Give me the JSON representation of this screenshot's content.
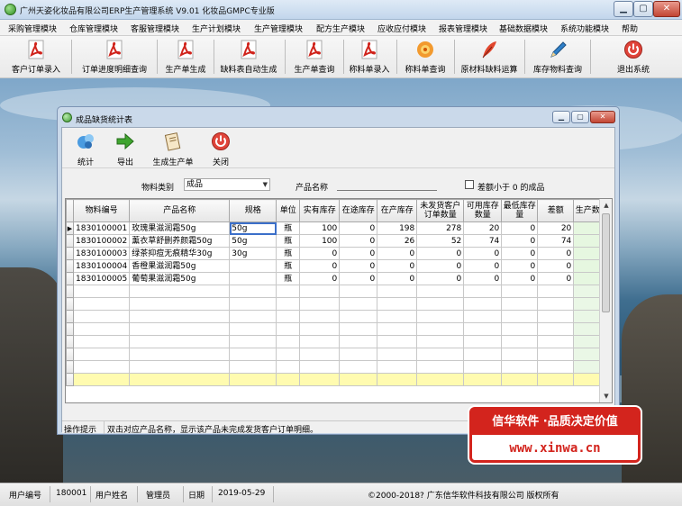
{
  "window": {
    "title": "广州天姿化妆品有限公司ERP生产管理系统  V9.01 化妆品GMPC专业版"
  },
  "menu": [
    "采购管理模块",
    "仓库管理模块",
    "客服管理模块",
    "生产计划模块",
    "生产管理模块",
    "配方生产模块",
    "应收应付模块",
    "报表管理模块",
    "基础数据模块",
    "系统功能模块",
    "帮助"
  ],
  "toolbar": [
    {
      "label": "客户订单录入",
      "icon": "pdf-document-icon"
    },
    {
      "label": "订单进度明细查询",
      "icon": "pdf-document-icon"
    },
    {
      "label": "生产单生成",
      "icon": "pdf-document-icon"
    },
    {
      "label": "缺料表自动生成",
      "icon": "pdf-document-icon"
    },
    {
      "label": "生产单查询",
      "icon": "pdf-document-icon"
    },
    {
      "label": "称料单录入",
      "icon": "pdf-document-icon"
    },
    {
      "label": "称料单查询",
      "icon": "gear-flower-icon"
    },
    {
      "label": "原材料缺料运算",
      "icon": "feather-quill-icon"
    },
    {
      "label": "库存物料查询",
      "icon": "pen-icon"
    },
    {
      "label": "退出系统",
      "icon": "power-icon"
    }
  ],
  "child": {
    "title": "成品缺货统计表",
    "toolbar": [
      "统计",
      "导出",
      "生成生产单",
      "关闭"
    ],
    "filter": {
      "category_label": "物料类别",
      "category_value": "成品",
      "product_label": "产品名称",
      "product_value": "",
      "checkbox_label": "差额小于 0 的成品"
    },
    "columns": [
      "物料编号",
      "产品名称",
      "规格",
      "单位",
      "实有库存",
      "在途库存",
      "在产库存",
      "未发货客户订单数量",
      "可用库存数量",
      "最低库存量",
      "差额",
      "生产数量"
    ],
    "rows": [
      [
        "1830100001",
        "玫瑰果滋润霜50g",
        "50g",
        "瓶",
        "100",
        "0",
        "198",
        "278",
        "20",
        "0",
        "20",
        ""
      ],
      [
        "1830100002",
        "薰衣草舒删养颜霜50g",
        "50g",
        "瓶",
        "100",
        "0",
        "26",
        "52",
        "74",
        "0",
        "74",
        ""
      ],
      [
        "1830100003",
        "绿茶抑痘无痕精华30g",
        "30g",
        "瓶",
        "0",
        "0",
        "0",
        "0",
        "0",
        "0",
        "0",
        ""
      ],
      [
        "1830100004",
        "香橙果滋润霜50g",
        "",
        "瓶",
        "0",
        "0",
        "0",
        "0",
        "0",
        "0",
        "0",
        ""
      ],
      [
        "1830100005",
        "葡萄果滋润霜50g",
        "",
        "瓶",
        "0",
        "0",
        "0",
        "0",
        "0",
        "0",
        "0",
        ""
      ]
    ],
    "hint_label": "操作提示",
    "hint_text": "双击对应产品名称，显示该产品未完成发货客户订单明细。"
  },
  "ad": {
    "line1": "信华软件 ·品质决定价值",
    "line2": "www.xinwa.cn"
  },
  "status": {
    "user_no_label": "用户编号",
    "user_no": "180001",
    "user_name_label": "用户姓名",
    "user_name": "管理员",
    "date_label": "日期",
    "date": "2019-05-29",
    "copyright": "©2000-2018?    广东信华软件科技有限公司    版权所有"
  }
}
